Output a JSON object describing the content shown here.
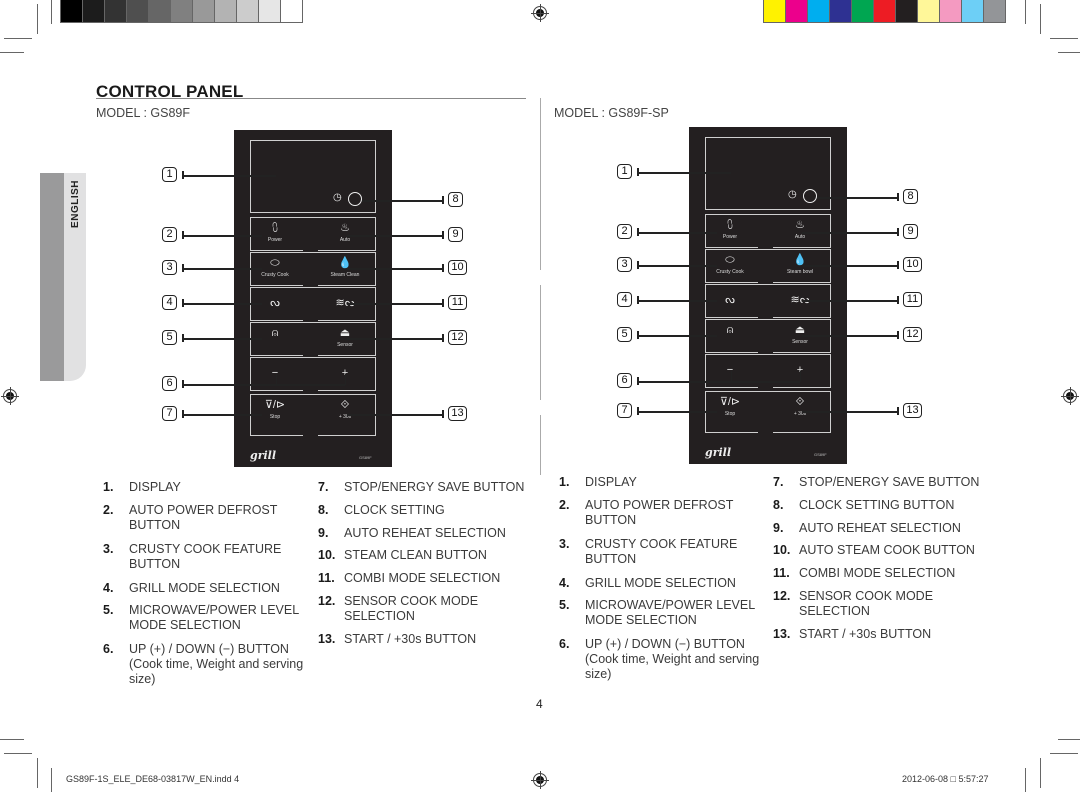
{
  "print_marks": {
    "grayscale_swatches": [
      "#000000",
      "#1c1c1c",
      "#333333",
      "#4f4f4f",
      "#666666",
      "#808080",
      "#999999",
      "#b3b3b3",
      "#cccccc",
      "#e6e6e6",
      "#ffffff"
    ],
    "color_swatches": [
      "#fff200",
      "#ec008c",
      "#00aeef",
      "#2e3192",
      "#00a651",
      "#ed1c24",
      "#231f20",
      "#fff799",
      "#f49ac1",
      "#6dcff6",
      "#939598"
    ]
  },
  "side_tab": {
    "label": "ENGLISH"
  },
  "header": {
    "title": "CONTROL PANEL"
  },
  "models": [
    {
      "label": "MODEL : GS89F",
      "panel": {
        "brand": "grill",
        "model_code": "GS89F",
        "buttons": {
          "power": "Power",
          "auto": "Auto",
          "crusty_cook": "Crusty Cook",
          "steam": "Steam Clean",
          "sensor": "Sensor",
          "minus": "−",
          "plus": "+",
          "stop": "Stop",
          "start": "+ 30s"
        }
      },
      "callouts": [
        "1",
        "2",
        "3",
        "4",
        "5",
        "6",
        "7",
        "8",
        "9",
        "10",
        "11",
        "12",
        "13"
      ],
      "legend_left": [
        {
          "num": "1.",
          "text": "DISPLAY"
        },
        {
          "num": "2.",
          "text": "AUTO POWER DEFROST BUTTON"
        },
        {
          "num": "3.",
          "text": "CRUSTY COOK FEATURE BUTTON"
        },
        {
          "num": "4.",
          "text": "GRILL MODE SELECTION"
        },
        {
          "num": "5.",
          "text": "MICROWAVE/POWER LEVEL MODE SELECTION"
        },
        {
          "num": "6.",
          "text": "UP (+) / DOWN (−) BUTTON (Cook time, Weight and serving size)"
        }
      ],
      "legend_right": [
        {
          "num": "7.",
          "text": "STOP/ENERGY SAVE BUTTON"
        },
        {
          "num": "8.",
          "text": "CLOCK SETTING"
        },
        {
          "num": "9.",
          "text": "AUTO REHEAT SELECTION"
        },
        {
          "num": "10.",
          "text": "STEAM CLEAN BUTTON"
        },
        {
          "num": "11.",
          "text": "COMBI MODE SELECTION"
        },
        {
          "num": "12.",
          "text": "SENSOR COOK MODE SELECTION"
        },
        {
          "num": "13.",
          "text": "START / +30s BUTTON"
        }
      ]
    },
    {
      "label": "MODEL : GS89F-SP",
      "panel": {
        "brand": "grill",
        "model_code": "GS89F",
        "buttons": {
          "power": "Power",
          "auto": "Auto",
          "crusty_cook": "Crusty Cook",
          "steam": "Steam bowl",
          "sensor": "Sensor",
          "minus": "−",
          "plus": "+",
          "stop": "Stop",
          "start": "+ 30s"
        }
      },
      "callouts": [
        "1",
        "2",
        "3",
        "4",
        "5",
        "6",
        "7",
        "8",
        "9",
        "10",
        "11",
        "12",
        "13"
      ],
      "legend_left": [
        {
          "num": "1.",
          "text": "DISPLAY"
        },
        {
          "num": "2.",
          "text": "AUTO POWER DEFROST BUTTON"
        },
        {
          "num": "3.",
          "text": "CRUSTY COOK FEATURE BUTTON"
        },
        {
          "num": "4.",
          "text": "GRILL MODE SELECTION"
        },
        {
          "num": "5.",
          "text": "MICROWAVE/POWER LEVEL MODE SELECTION"
        },
        {
          "num": "6.",
          "text": "UP (+) / DOWN (−) BUTTON (Cook time, Weight and serving size)"
        }
      ],
      "legend_right": [
        {
          "num": "7.",
          "text": "STOP/ENERGY SAVE BUTTON"
        },
        {
          "num": "8.",
          "text": "CLOCK SETTING BUTTON"
        },
        {
          "num": "9.",
          "text": "AUTO REHEAT SELECTION"
        },
        {
          "num": "10.",
          "text": "AUTO STEAM COOK BUTTON"
        },
        {
          "num": "11.",
          "text": "COMBI MODE SELECTION"
        },
        {
          "num": "12.",
          "text": "SENSOR COOK MODE SELECTION"
        },
        {
          "num": "13.",
          "text": "START / +30s BUTTON"
        }
      ]
    }
  ],
  "page_number": "4",
  "footer": {
    "file": "GS89F-1S_ELE_DE68-03817W_EN.indd   4",
    "timestamp": "2012-06-08   □ 5:57:27"
  }
}
